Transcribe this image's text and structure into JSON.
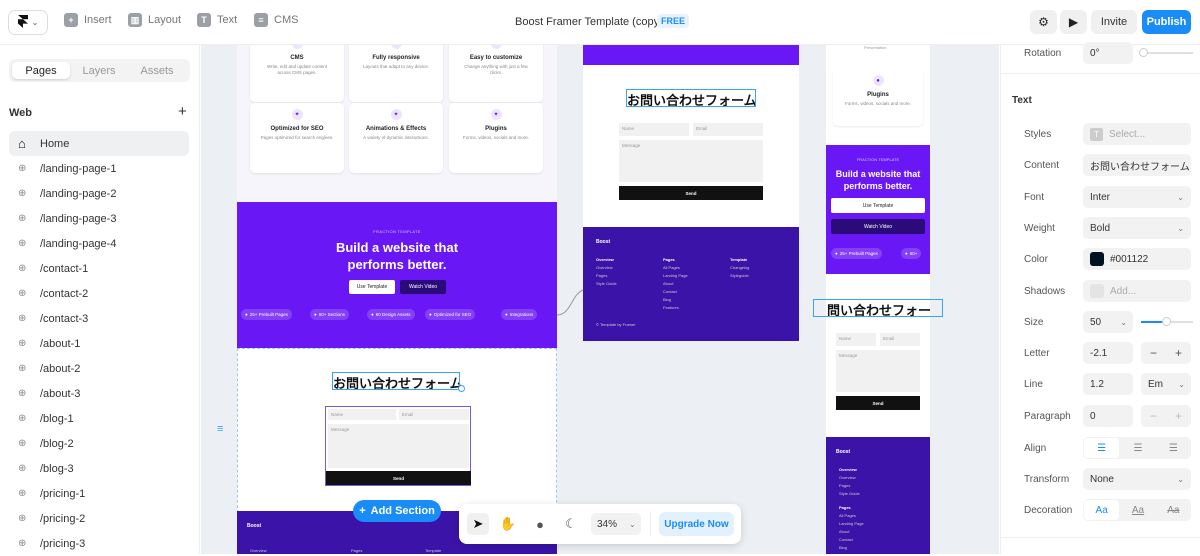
{
  "topbar": {
    "insert": "Insert",
    "layout": "Layout",
    "text": "Text",
    "cms": "CMS",
    "title": "Boost Framer Template (copy)",
    "badge": "FREE",
    "invite": "Invite",
    "publish": "Publish"
  },
  "left": {
    "tabs": [
      "Pages",
      "Layers",
      "Assets"
    ],
    "section": "Web",
    "pages": [
      "Home",
      "/landing-page-1",
      "/landing-page-2",
      "/landing-page-3",
      "/landing-page-4",
      "/contact-1",
      "/contact-2",
      "/contact-3",
      "/about-1",
      "/about-2",
      "/about-3",
      "/blog-1",
      "/blog-2",
      "/blog-3",
      "/pricing-1",
      "/pricing-2",
      "/pricing-3"
    ]
  },
  "canvas": {
    "cards": [
      {
        "title": "CMS",
        "desc": "Write, edit and update content across CMS pages."
      },
      {
        "title": "Fully responsive",
        "desc": "Layouts that adapt to any device."
      },
      {
        "title": "Easy to customize",
        "desc": "Change anything with just a few clicks."
      },
      {
        "title": "Optimized for SEO",
        "desc": "Pages optimized for search engines."
      },
      {
        "title": "Animations & Effects",
        "desc": "A variety of dynamic interactions."
      },
      {
        "title": "Plugins",
        "desc": "Forms, videos, socials and more."
      }
    ],
    "hero_eyebrow": "FRACTION TEMPLATE",
    "hero_title_1": "Build a website that",
    "hero_title_2": "performs better.",
    "use_template": "Use Template",
    "watch_video": "Watch Video",
    "pills": [
      "25+ Prebuilt Pages",
      "60+ Sections",
      "60 Design Assets",
      "Optimized for SEO",
      "Integrations"
    ],
    "form_title": "お問い合わせフォーム",
    "form_title_clipped": "問い合わせフォー",
    "name_placeholder": "Name",
    "email_placeholder": "Email",
    "message_placeholder": "Message",
    "send": "Send",
    "add_section": "Add Section",
    "footer_brand": "Boost",
    "footer_cols": [
      {
        "head": "Overview",
        "items": [
          "Overview",
          "Pages",
          "Style Guide"
        ]
      },
      {
        "head": "Pages",
        "items": [
          "All Pages",
          "Landing Page",
          "About",
          "Contact",
          "Blog",
          "Features"
        ]
      },
      {
        "head": "Template",
        "items": [
          "Changelog",
          "Styleguide"
        ]
      }
    ],
    "footer_note": "© Template by Framer",
    "small_plugins_title": "Plugins",
    "small_plugins_desc": "Forms, videos, socials and more.",
    "small_top_note": "Presentation",
    "small_hero_pills": [
      "25+ Prebuilt Pages",
      "60+"
    ]
  },
  "bottombar": {
    "zoom": "34%",
    "upgrade": "Upgrade Now"
  },
  "right": {
    "rotation_label": "Rotation",
    "rotation_value": "0°",
    "section_text": "Text",
    "styles_label": "Styles",
    "styles_placeholder": "Select...",
    "content_label": "Content",
    "content_value": "お問い合わせフォーム",
    "font_label": "Font",
    "font_value": "Inter",
    "weight_label": "Weight",
    "weight_value": "Bold",
    "color_label": "Color",
    "color_value": "#001122",
    "color_swatch": "#001122",
    "shadows_label": "Shadows",
    "shadows_placeholder": "Add...",
    "size_label": "Size",
    "size_value": "50",
    "letter_label": "Letter",
    "letter_value": "-2.1",
    "line_label": "Line",
    "line_value": "1.2",
    "line_unit": "Em",
    "paragraph_label": "Paragraph",
    "paragraph_value": "0",
    "align_label": "Align",
    "transform_label": "Transform",
    "transform_value": "None",
    "decoration_label": "Decoration",
    "decoration_options": [
      "Aa",
      "Aa",
      "Aa"
    ]
  },
  "colors": {
    "accent": "#1a8cf8",
    "brand_purple": "#6a17f5",
    "footer_purple": "#3b13a8"
  }
}
